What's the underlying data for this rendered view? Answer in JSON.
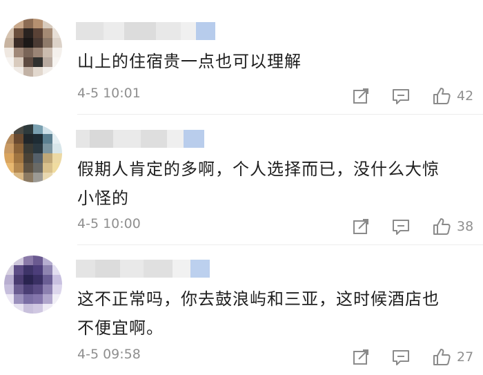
{
  "comments": [
    {
      "text_lines": [
        "山上的住宿贵一点也可以理解"
      ],
      "time": "4-5 10:01",
      "likes": "42",
      "avatar_colors": [
        "#e8e4e0",
        "#c9a98c",
        "#8c6c54",
        "#b59070",
        "#d8cbbd",
        "#f2eeea",
        "#d6c3b0",
        "#6b4f3d",
        "#2a2320",
        "#5a4236",
        "#a48a74",
        "#e7dfd6",
        "#c7b3a0",
        "#3b2c26",
        "#1c1817",
        "#4a3a33",
        "#8e7a6a",
        "#dcd2c8",
        "#efe8e1",
        "#a08878",
        "#7a6558",
        "#9b8576",
        "#cbbcaf",
        "#f4f0ec",
        "#f6f3f0",
        "#d9cbbe",
        "#5d4a40",
        "#30302e",
        "#b8aaa0",
        "#f7f4f1",
        "#fbfaf8",
        "#f0ebe6",
        "#c2b2a5",
        "#e2d8ce",
        "#f3efeb",
        "#fcfbfa"
      ]
    },
    {
      "text_lines": [
        "假期人肯定的多啊，个人选择而已，没什么大惊",
        "小怪的"
      ],
      "time": "4-5 10:00",
      "likes": "38",
      "avatar_colors": [
        "#eef0f0",
        "#4a4a44",
        "#2e3a3c",
        "#7aa0b0",
        "#cfe0e8",
        "#f1f4f5",
        "#b48a5c",
        "#6a4a30",
        "#20262a",
        "#1e2c34",
        "#5b7f90",
        "#e4eef2",
        "#c99a64",
        "#8a6238",
        "#3a3a34",
        "#2a3840",
        "#7c95a0",
        "#d8e6ea",
        "#d9a45e",
        "#a07440",
        "#4a4236",
        "#55606a",
        "#c0a878",
        "#ecd9a4",
        "#e8b870",
        "#b48850",
        "#5e5242",
        "#6a6a66",
        "#d8c08c",
        "#f0dca0",
        "#f4e6cc",
        "#d9b884",
        "#8c7a62",
        "#9c9a94",
        "#e8d8b0",
        "#f8f0dc"
      ]
    },
    {
      "text_lines": [
        "这不正常吗，你去鼓浪屿和三亚，这时候酒店也",
        "不便宜啊。"
      ],
      "time": "4-5 09:58",
      "likes": "27",
      "avatar_colors": [
        "#f2f0f4",
        "#cfc8dc",
        "#8a7aa8",
        "#6a5a90",
        "#b6aed0",
        "#f4f2f6",
        "#d6d0e0",
        "#5e4e86",
        "#3e3468",
        "#4c3e7a",
        "#8e84b0",
        "#e2def0",
        "#b8aed0",
        "#4a3c70",
        "#2a2450",
        "#3a3064",
        "#6a5e94",
        "#c8c0e0",
        "#c6bedc",
        "#6a5c90",
        "#4a3e74",
        "#5a4c84",
        "#8c80b0",
        "#dcd6ec",
        "#ece8f4",
        "#9a90bc",
        "#7a6ea4",
        "#8476ac",
        "#b0a6cc",
        "#f0eef6",
        "#faf9fc",
        "#e6e2f0",
        "#c8c0dc",
        "#d0c8e2",
        "#eeebf5",
        "#fbfafd"
      ]
    }
  ]
}
